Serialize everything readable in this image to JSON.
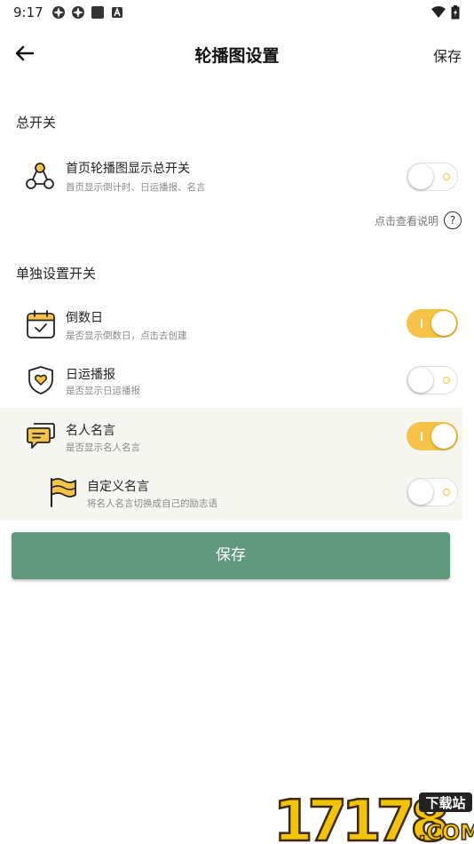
{
  "status_bar": {
    "time": "9:17"
  },
  "app_bar": {
    "title": "轮播图设置",
    "save_label": "保存"
  },
  "sections": {
    "master": "总开关",
    "individual": "单独设置开关"
  },
  "master_switch": {
    "label": "首页轮播图显示总开关",
    "subtitle": "首页显示倒计时、日运播报、名言",
    "on": false
  },
  "help_link": {
    "label": "点击查看说明",
    "icon": "?"
  },
  "items": [
    {
      "label": "倒数日",
      "subtitle": "是否显示倒数日，点击去创建",
      "on": true,
      "icon": "calendar-icon"
    },
    {
      "label": "日运播报",
      "subtitle": "是否显示日运播报",
      "on": false,
      "icon": "shield-heart-icon"
    },
    {
      "label": "名人名言",
      "subtitle": "是否显示名人名言",
      "on": true,
      "icon": "chat-bubble-icon"
    },
    {
      "label": "自定义名言",
      "subtitle": "将名人名言切换成自己的励志语",
      "on": false,
      "icon": "flag-icon"
    }
  ],
  "save_button": {
    "label": "保存"
  },
  "watermark": {
    "number": "17178",
    "badge": "下载站",
    "suffix": ".COM"
  },
  "colors": {
    "accent": "#f7c347",
    "save_button": "#61997f",
    "highlight_bg": "#f6f6f1"
  }
}
